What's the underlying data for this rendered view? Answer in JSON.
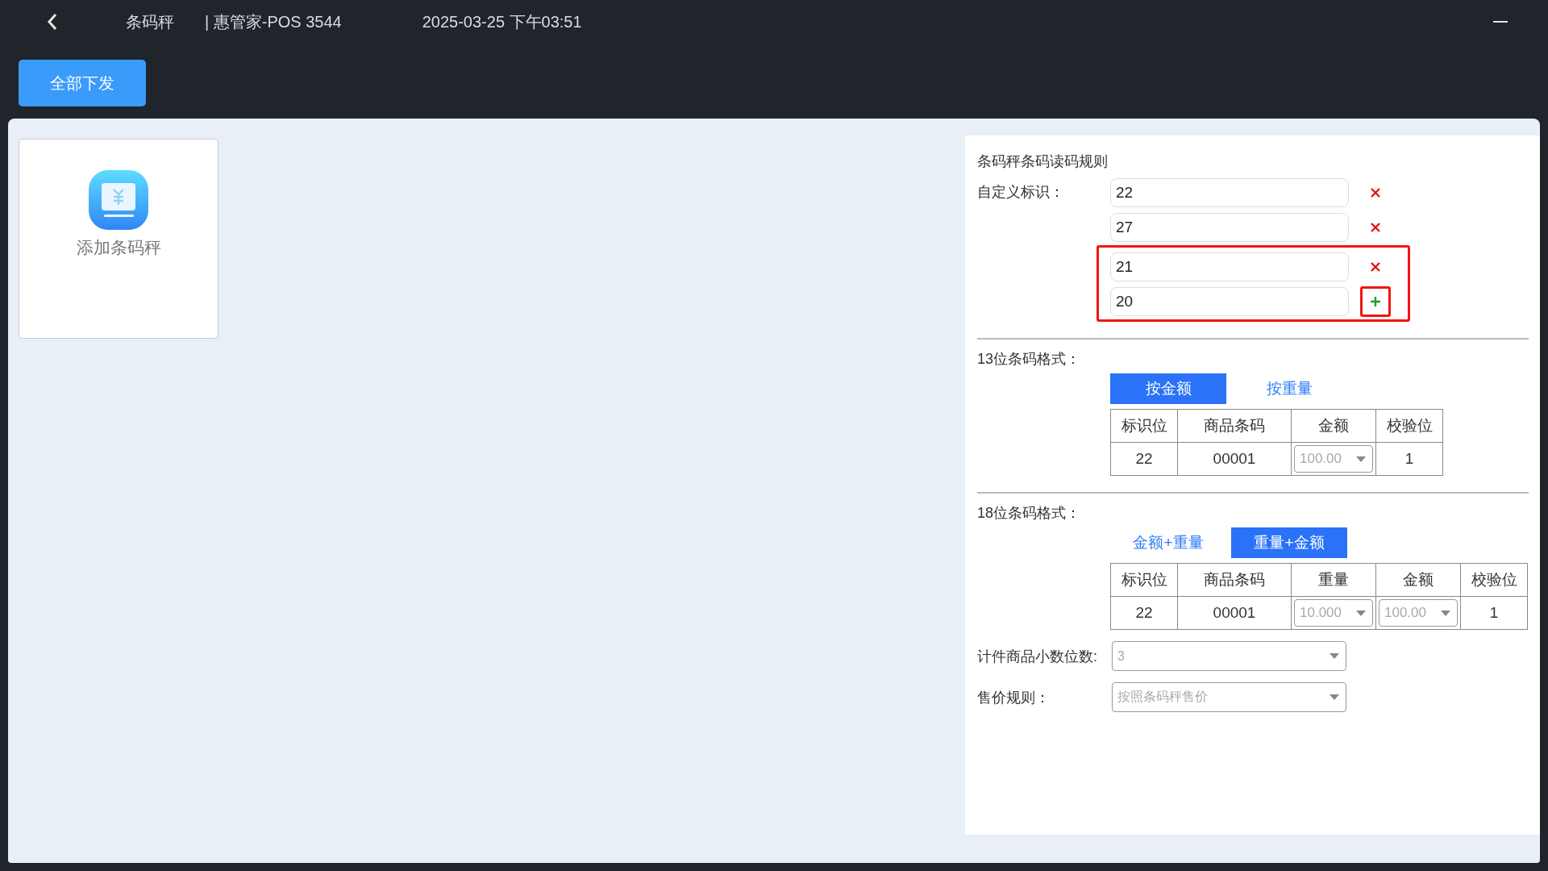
{
  "header": {
    "title": "条码秤",
    "store": "| 惠管家-POS 3544",
    "datetime": "2025-03-25 下午03:51"
  },
  "toolbar": {
    "button": "全部下发"
  },
  "add_card": {
    "label": "添加条码秤"
  },
  "rules": {
    "title": "条码秤条码读码规则",
    "identifier_label": "自定义标识：",
    "identifiers": [
      {
        "value": "22",
        "kind": "remove",
        "highlighted": false,
        "button_highlighted": false
      },
      {
        "value": "27",
        "kind": "remove",
        "highlighted": false,
        "button_highlighted": false
      },
      {
        "value": "21",
        "kind": "remove",
        "highlighted": true,
        "button_highlighted": false
      },
      {
        "value": "20",
        "kind": "add",
        "highlighted": true,
        "button_highlighted": true
      }
    ]
  },
  "formats": [
    {
      "label": "13位条码格式：",
      "options": [
        {
          "label": "按金额",
          "selected": true
        },
        {
          "label": "按重量",
          "selected": false
        }
      ],
      "table": {
        "columns": [
          "标识位",
          "商品条码",
          "金额",
          "校验位"
        ],
        "row": [
          {
            "kind": "text",
            "value": "22"
          },
          {
            "kind": "text",
            "value": "00001"
          },
          {
            "kind": "select",
            "value": "100.00"
          },
          {
            "kind": "text",
            "value": "1"
          }
        ]
      }
    },
    {
      "label": "18位条码格式：",
      "options": [
        {
          "label": "金额+重量",
          "selected": false
        },
        {
          "label": "重量+金额",
          "selected": true
        }
      ],
      "table": {
        "columns": [
          "标识位",
          "商品条码",
          "重量",
          "金额",
          "校验位"
        ],
        "row": [
          {
            "kind": "text",
            "value": "22"
          },
          {
            "kind": "text",
            "value": "00001"
          },
          {
            "kind": "select",
            "value": "10.000"
          },
          {
            "kind": "select",
            "value": "100.00"
          },
          {
            "kind": "text",
            "value": "1"
          }
        ]
      }
    }
  ],
  "settings": [
    {
      "label": "计件商品小数位数:",
      "value": "3"
    },
    {
      "label": "售价规则：",
      "value": "按照条码秤售价"
    }
  ]
}
